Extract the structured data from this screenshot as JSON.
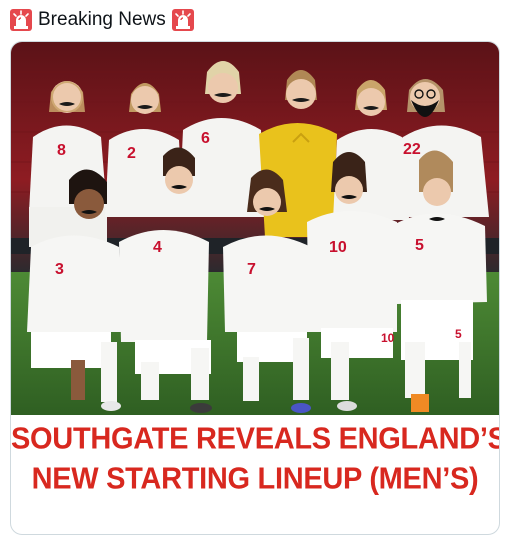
{
  "post": {
    "header_text": "Breaking News",
    "leading_icon": "police-siren-icon",
    "trailing_icon": "police-siren-icon"
  },
  "media": {
    "image_subject": "England women's football team photo with drawn-on moustaches",
    "jersey_numbers_back_row": [
      "8",
      "2",
      "6",
      "22"
    ],
    "jersey_numbers_front_row": [
      "3",
      "4",
      "7",
      "10",
      "5"
    ],
    "headline_line1": "SOUTHGATE REVEALS ENGLAND’S",
    "headline_line2": "NEW STARTING LINEUP (MEN’S)"
  },
  "colors": {
    "headline_red": "#d8281f",
    "kit_white": "#f4f4f2",
    "goalkeeper_yellow": "#e9c21c",
    "pitch_green": "#3f7a2e",
    "stadium_red": "#8e1c22"
  }
}
